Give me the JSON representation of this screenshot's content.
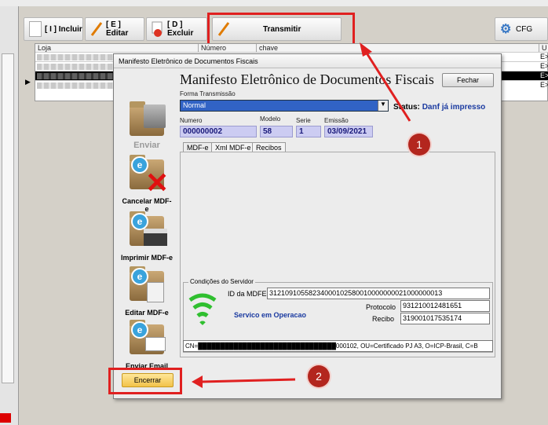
{
  "toolbar": {
    "incluir_label": "[ I ] Incluir",
    "editar_label": "[ E ] Editar",
    "excluir_label": "[ D ] Excluir",
    "transmitir_label": "Transmitir",
    "cfg_label": "CFG"
  },
  "grid": {
    "headers": [
      "Loja",
      "Número",
      "chave",
      "U"
    ],
    "row_suffix": [
      "E>",
      "E>",
      "E>",
      "E>"
    ]
  },
  "dialog": {
    "window_title": "Manifesto Eletrônico de Documentos Fiscais",
    "heading": "Manifesto Eletrônico de Documentos Fiscais",
    "fechar_label": "Fechar",
    "forma_label": "Forma Transmissão",
    "forma_value": "Normal",
    "status_label": "Status:",
    "status_value": "Danf já impresso",
    "numero_label": "Numero",
    "numero_value": "000000002",
    "modelo_label": "Modelo",
    "modelo_value": "58",
    "serie_label": "Serie",
    "serie_value": "1",
    "emissao_label": "Emissão",
    "emissao_value": "03/09/2021",
    "tabs": [
      "MDF-e",
      "Xml MDF-e",
      "Recibos"
    ],
    "side": {
      "enviar": "Enviar",
      "cancelar": "Cancelar MDF-e",
      "imprimir": "Imprimir MDF-e",
      "editar": "Editar MDF-e",
      "email": "Enviar Email"
    },
    "servidor": {
      "title": "Condições do Servidor",
      "id_label": "ID da MDFE",
      "id_value": "31210910558234000102580010000000021000000013",
      "status": "Servico em Operacao",
      "protocolo_label": "Protocolo",
      "protocolo_value": "931210012481651",
      "recibo_label": "Recibo",
      "recibo_value": "319001017535174",
      "cert_value": "CN=███████████████████████████████000102, OU=Certificado PJ A3, O=ICP-Brasil, C=B"
    },
    "encerrar_label": "Encerrar"
  },
  "annotations": {
    "badge1": "1",
    "badge2": "2",
    "red": "#e02020"
  }
}
